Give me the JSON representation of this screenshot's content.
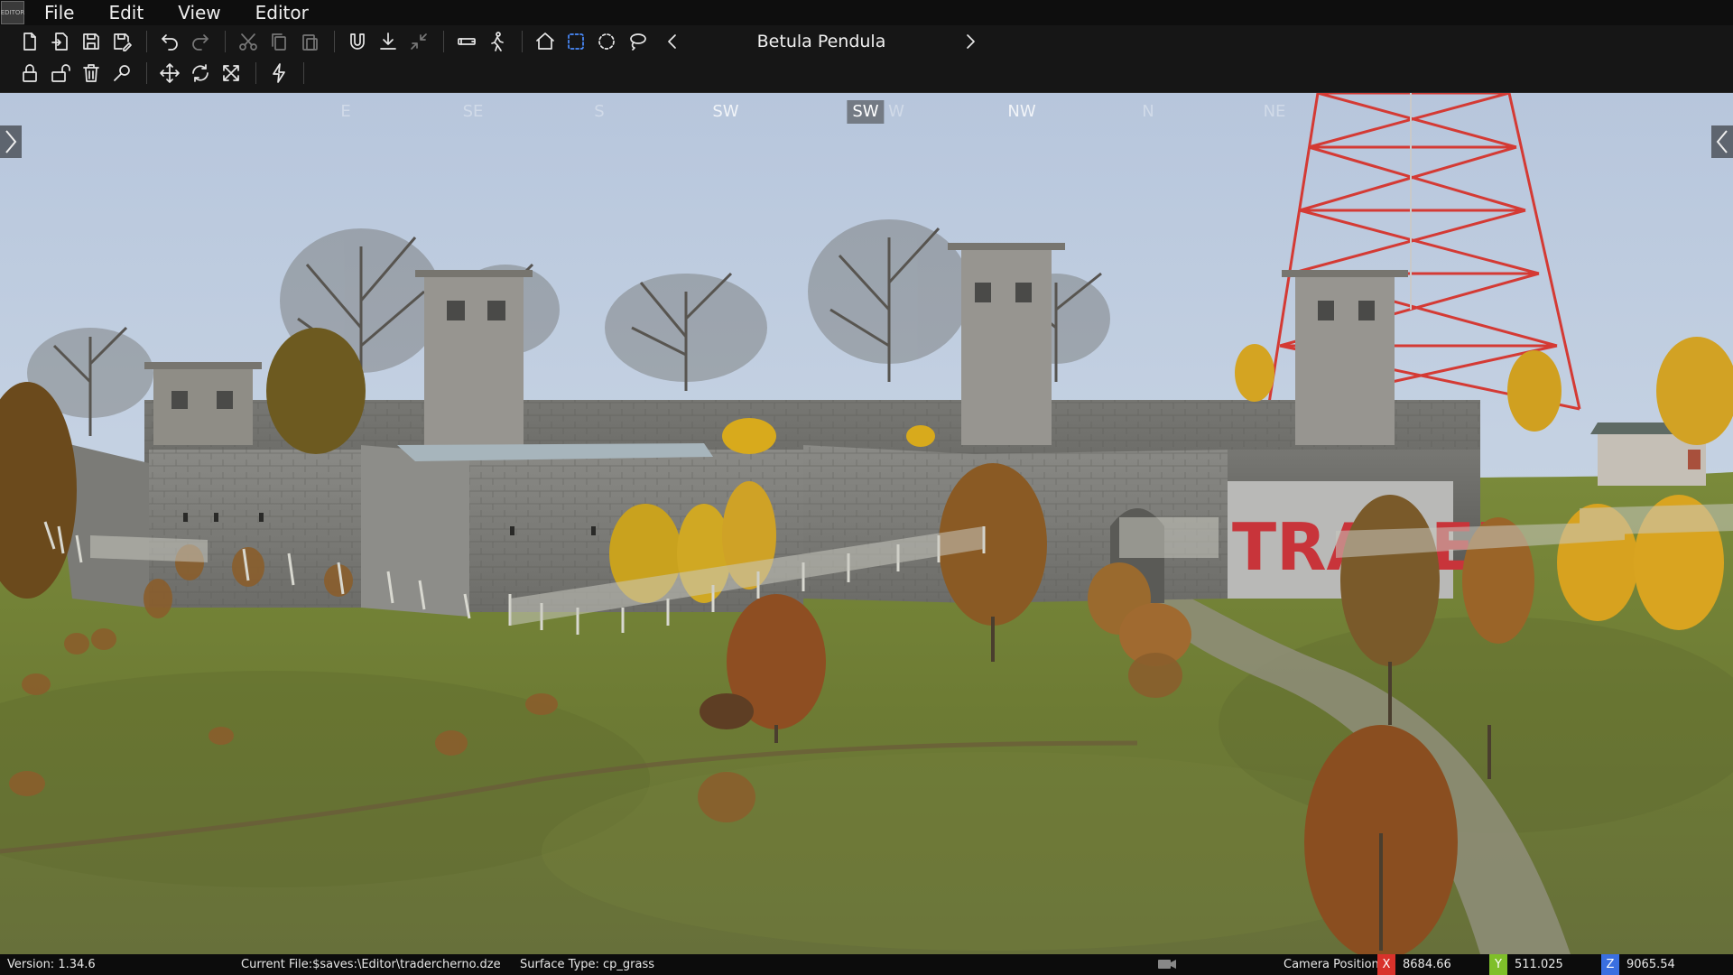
{
  "menubar": {
    "logo_text": "EDITOR",
    "items": [
      "File",
      "Edit",
      "View",
      "Editor"
    ]
  },
  "toolbar": {
    "row1_icons": [
      "new-file-icon",
      "import-file-icon",
      "save-icon",
      "save-as-icon",
      "undo-icon",
      "redo-icon",
      "cut-icon",
      "copy-icon",
      "paste-icon",
      "magnet-icon",
      "ground-snap-icon",
      "collapse-icon",
      "binoculars-icon",
      "walk-icon",
      "home-icon",
      "box-select-icon",
      "circle-select-icon",
      "lasso-select-icon"
    ],
    "row2_icons": [
      "lock-icon",
      "unlock-icon",
      "trash-icon",
      "search-icon",
      "move-icon",
      "rotate-icon",
      "scale-icon",
      "lightning-icon"
    ],
    "active_tool": "box-select-icon",
    "brush_name": "Betula Pendula"
  },
  "compass": {
    "labels": [
      {
        "text": "E",
        "style": "faint"
      },
      {
        "text": "SE",
        "style": "faint"
      },
      {
        "text": "S",
        "style": "faint"
      },
      {
        "text": "SW",
        "style": "mid"
      },
      {
        "text": "SW",
        "style": "current"
      },
      {
        "text": "W",
        "style": "faint"
      },
      {
        "text": "NW",
        "style": "mid"
      },
      {
        "text": "N",
        "style": "faint"
      },
      {
        "text": "NE",
        "style": "faint"
      }
    ]
  },
  "scene": {
    "sign_text": "TRADER"
  },
  "status": {
    "version": "Version:  1.34.6",
    "current_file": "Current File:$saves:\\Editor\\tradercherno.dze",
    "surface_type": "Surface Type: cp_grass",
    "camera_label": "Camera Position",
    "x_label": "X",
    "x_value": "8684.66",
    "y_label": "Y",
    "y_value": "511.025",
    "z_label": "Z",
    "z_value": "9065.54",
    "colors": {
      "x": "#d9322b",
      "y": "#7fbf2a",
      "z": "#3a6fe0"
    }
  }
}
